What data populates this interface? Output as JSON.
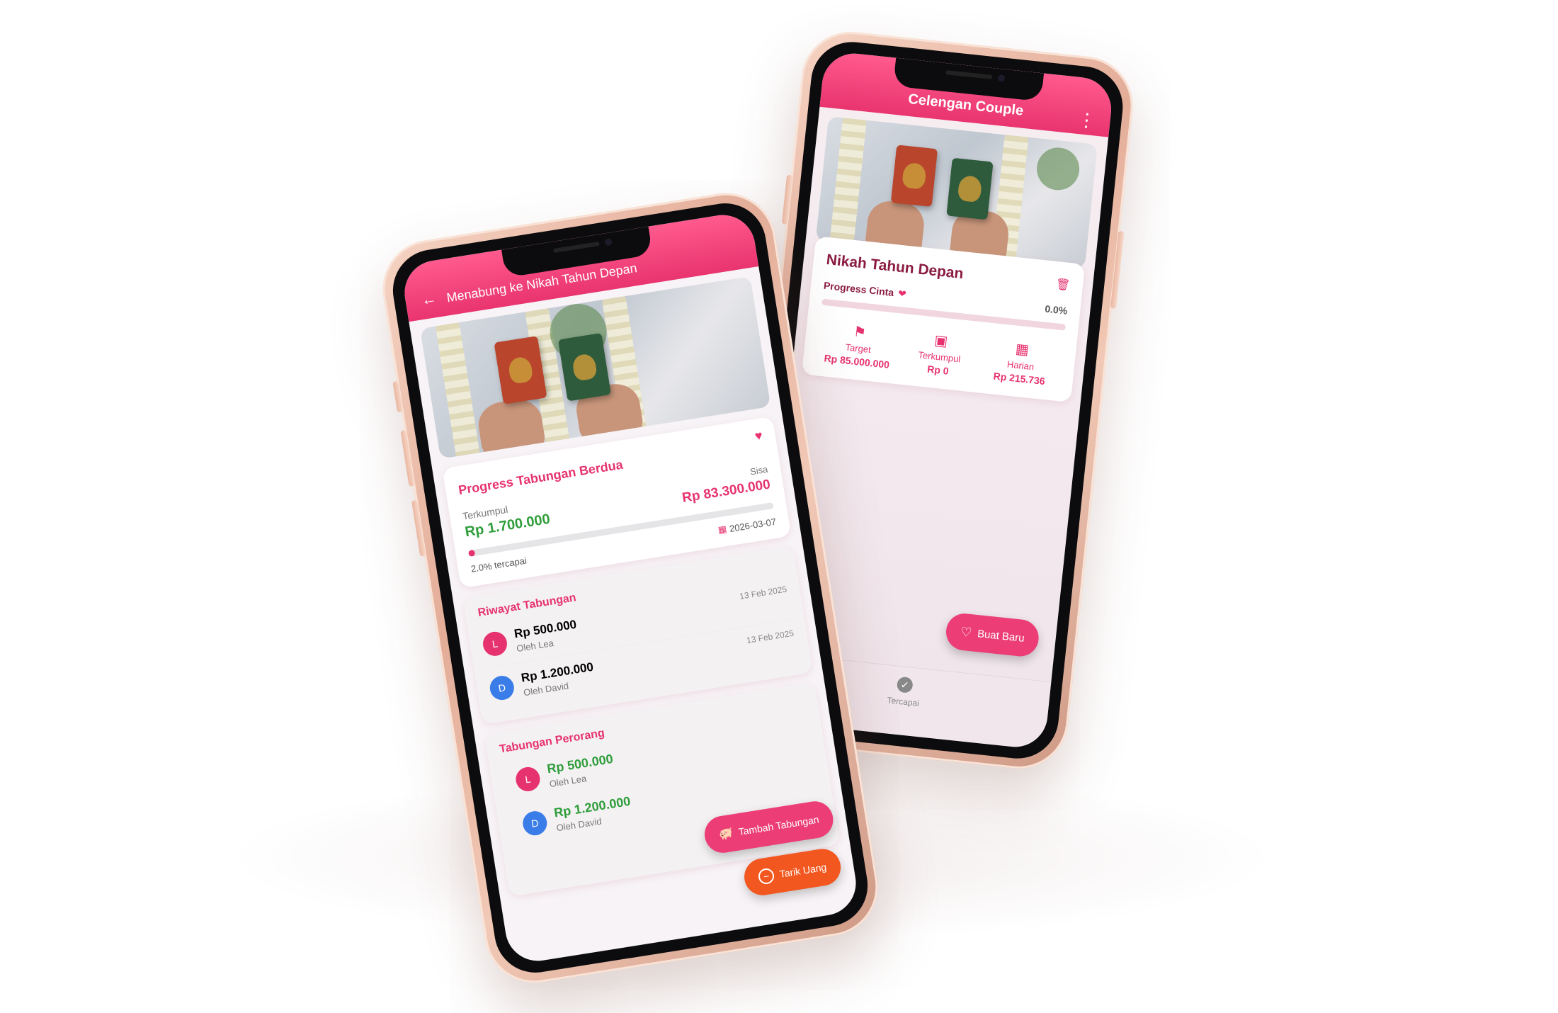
{
  "colors": {
    "accent": "#e6336f",
    "green": "#2e9d3a",
    "orange": "#f1571f",
    "blue": "#3b7de8"
  },
  "phone_a": {
    "appbar": {
      "title": "Menabung ke Nikah Tahun Depan",
      "back_icon": "arrow-left-icon"
    },
    "progress_card": {
      "title": "Progress Tabungan Berdua",
      "collected_label": "Terkumpul",
      "collected_value": "Rp 1.700.000",
      "remaining_label": "Sisa",
      "remaining_value": "Rp 83.300.000",
      "progress_fraction": 0.02,
      "percent_text": "2.0% tercapai",
      "date": "2026-03-07"
    },
    "history": {
      "title": "Riwayat Tabungan",
      "items": [
        {
          "initial": "L",
          "amount": "Rp 500.000",
          "by": "Oleh Lea",
          "date": "13 Feb 2025"
        },
        {
          "initial": "D",
          "amount": "Rp 1.200.000",
          "by": "Oleh David",
          "date": "13 Feb 2025"
        }
      ]
    },
    "personal": {
      "title": "Tabungan Perorang",
      "items": [
        {
          "initial": "L",
          "amount": "Rp 500.000",
          "by": "Oleh Lea"
        },
        {
          "initial": "D",
          "amount": "Rp 1.200.000",
          "by": "Oleh David"
        }
      ]
    },
    "fab_add": "Tambah Tabungan",
    "fab_withdraw": "Tarik Uang"
  },
  "phone_b": {
    "appbar": {
      "title": "Celengan Couple"
    },
    "goal": {
      "title": "Nikah Tahun Depan",
      "progress_label": "Progress Cinta",
      "progress_fraction": 0.0,
      "percent_text": "0.0%",
      "stats": [
        {
          "icon": "flag-icon",
          "label": "Target",
          "value": "Rp 85.000.000"
        },
        {
          "icon": "wallet-icon",
          "label": "Terkumpul",
          "value": "Rp 0"
        },
        {
          "icon": "calendar-icon",
          "label": "Harian",
          "value": "Rp 215.736"
        }
      ]
    },
    "fab_new": "Buat Baru",
    "bottom_nav": {
      "label": "Tercapai"
    }
  }
}
